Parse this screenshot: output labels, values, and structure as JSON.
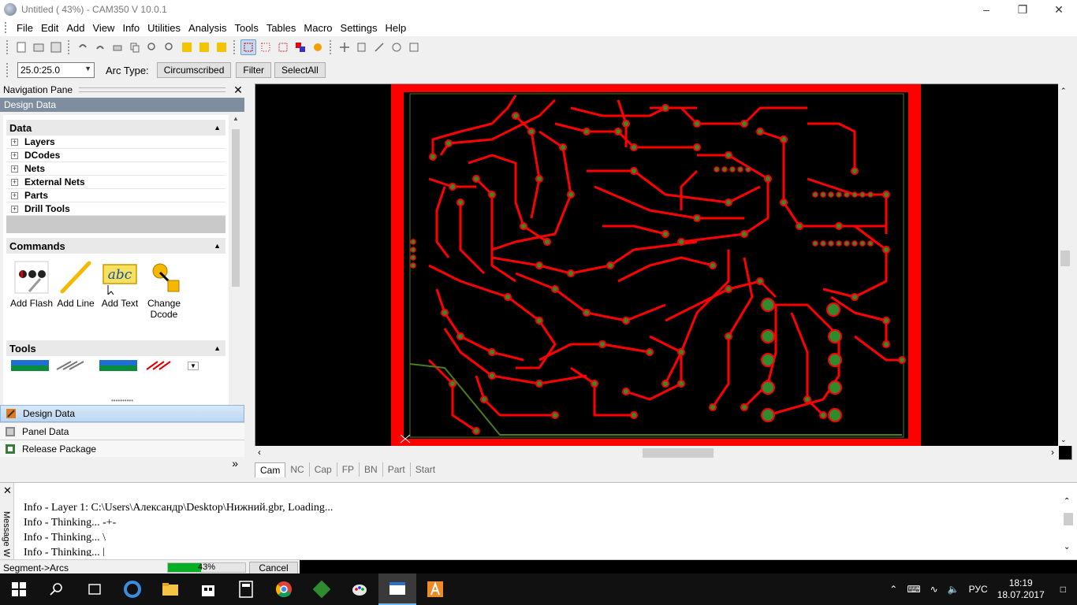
{
  "window": {
    "title": "Untitled ( 43%) - CAM350 V 10.0.1"
  },
  "menu": [
    "File",
    "Edit",
    "Add",
    "View",
    "Info",
    "Utilities",
    "Analysis",
    "Tools",
    "Tables",
    "Macro",
    "Settings",
    "Help"
  ],
  "arcbar": {
    "grid_value": "25.0:25.0",
    "arc_type_label": "Arc Type:",
    "arc_type_value": "Circumscribed",
    "filter_label": "Filter",
    "selectall_label": "SelectAll"
  },
  "navpane": {
    "title": "Navigation Pane",
    "section_title": "Design Data",
    "data_group": {
      "title": "Data",
      "items": [
        "Layers",
        "DCodes",
        "Nets",
        "External Nets",
        "Parts",
        "Drill Tools"
      ]
    },
    "commands_group": {
      "title": "Commands",
      "items": [
        {
          "label": "Add Flash"
        },
        {
          "label": "Add Line"
        },
        {
          "label": "Add Text"
        },
        {
          "label": "Change Dcode"
        }
      ]
    },
    "tools_group": {
      "title": "Tools"
    },
    "bottom_buttons": [
      "Design Data",
      "Panel Data",
      "Release Package"
    ]
  },
  "tabs": [
    "Cam",
    "NC",
    "Cap",
    "FP",
    "BN",
    "Part",
    "Start"
  ],
  "messages": {
    "side_label": "Message W",
    "lines": [
      "Info - Layer 1: C:\\Users\\Александр\\Desktop\\Нижний.gbr, Loading...",
      "Info - Thinking... -+-",
      "Info - Thinking... \\",
      "Info - Thinking... |"
    ]
  },
  "status": {
    "left_text": "Segment->Arcs",
    "progress_text": "43%",
    "progress_percent": 43,
    "cancel_label": "Cancel"
  },
  "taskbar": {
    "language": "РУС",
    "time": "18:19",
    "date": "18.07.2017"
  },
  "colors": {
    "trace": "#ff0000",
    "pad": "#2e8b2e",
    "board_bg": "#000000"
  }
}
